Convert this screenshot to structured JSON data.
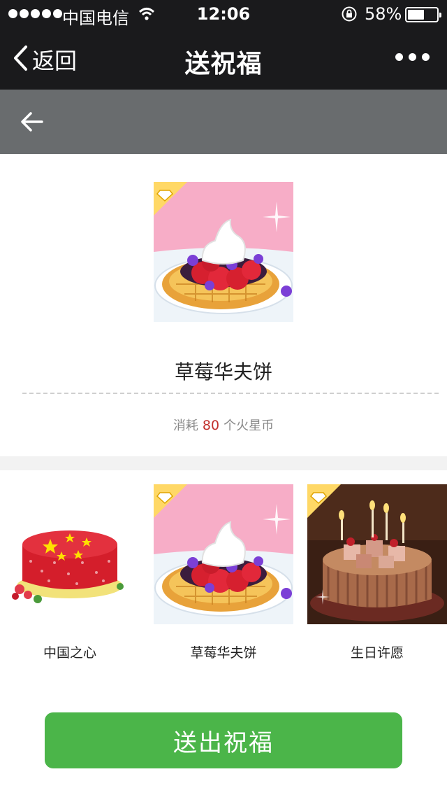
{
  "status_bar": {
    "carrier": "中国电信",
    "time": "12:06",
    "battery": "58%",
    "battery_level": 0.58
  },
  "nav": {
    "back_label": "返回",
    "title": "送祝福",
    "icons": [
      "chevron-left-icon",
      "more-icon"
    ]
  },
  "sub_header": {
    "icon": "arrow-left-icon"
  },
  "selected_gift": {
    "name": "草莓华夫饼",
    "cost_prefix": "消耗",
    "cost_amount": "80",
    "cost_suffix": "个火星币",
    "accent_color": "#c2302c"
  },
  "gifts": [
    {
      "name": "中国之心"
    },
    {
      "name": "草莓华夫饼"
    },
    {
      "name": "生日许愿"
    }
  ],
  "send_button": {
    "label": "送出祝福",
    "color": "#4bb549"
  }
}
